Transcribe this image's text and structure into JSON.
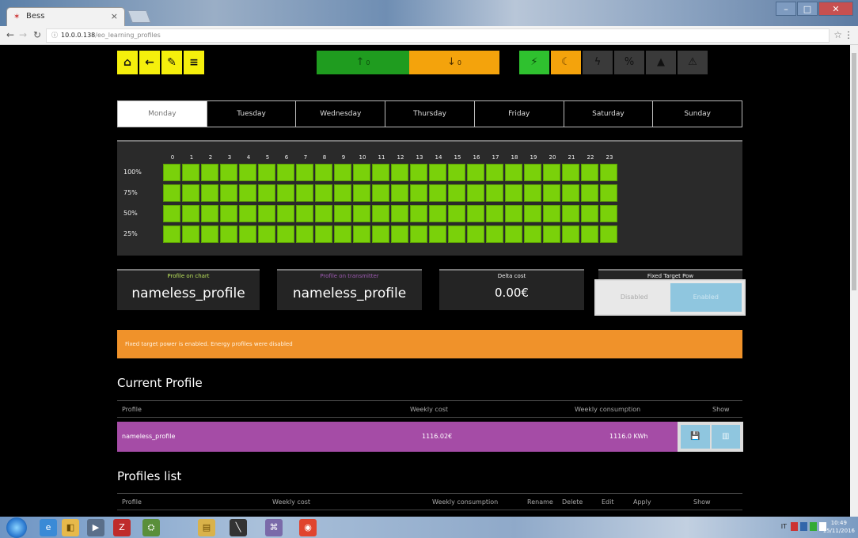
{
  "browser": {
    "tab_title": "Bess",
    "tab_favicon": "✶",
    "tab_close": "×",
    "url_host": "10.0.0.138",
    "url_path": "/eo_learning_profiles",
    "win_min": "–",
    "win_max": "□",
    "win_close": "✕"
  },
  "toolbar": {
    "nav_buttons": [
      {
        "name": "home-icon",
        "glyph": "⌂"
      },
      {
        "name": "back-arrow-icon",
        "glyph": "←"
      },
      {
        "name": "wrench-icon",
        "glyph": "✎"
      },
      {
        "name": "menu-icon",
        "glyph": "≡"
      }
    ],
    "power_in_glyph": "↑",
    "power_in_value": "0",
    "power_out_glyph": "↓",
    "power_out_value": "0",
    "status_icons": [
      {
        "name": "plug-icon",
        "glyph": "⚡",
        "state": "green"
      },
      {
        "name": "moon-icon",
        "glyph": "☾",
        "state": "orange"
      },
      {
        "name": "bolt-icon",
        "glyph": "ϟ",
        "state": "grey"
      },
      {
        "name": "percent-icon",
        "glyph": "%",
        "state": "grey"
      },
      {
        "name": "lock-icon",
        "glyph": "▲",
        "state": "grey"
      },
      {
        "name": "warning-icon",
        "glyph": "⚠",
        "state": "grey"
      }
    ],
    "colors": {
      "nav": "#f5ef0c",
      "power_in": "#1f9c1f",
      "power_out": "#f4a30c"
    }
  },
  "days": [
    "Monday",
    "Tuesday",
    "Wednesday",
    "Thursday",
    "Friday",
    "Saturday",
    "Sunday"
  ],
  "active_day": "Monday",
  "power_grid": {
    "hours": [
      "0",
      "1",
      "2",
      "3",
      "4",
      "5",
      "6",
      "7",
      "8",
      "9",
      "10",
      "11",
      "12",
      "13",
      "14",
      "15",
      "16",
      "17",
      "18",
      "19",
      "20",
      "21",
      "22",
      "23"
    ],
    "levels": [
      "100%",
      "75%",
      "50%",
      "25%"
    ],
    "selected_level_per_hour": [
      "100%",
      "100%",
      "100%",
      "100%",
      "100%",
      "100%",
      "100%",
      "100%",
      "100%",
      "100%",
      "100%",
      "100%",
      "100%",
      "100%",
      "100%",
      "100%",
      "100%",
      "100%",
      "100%",
      "100%",
      "100%",
      "100%",
      "100%",
      "100%"
    ],
    "cell_color": "#7ad10a"
  },
  "cards": {
    "profile_on_chart": {
      "caption": "Profile on chart",
      "value": "nameless_profile"
    },
    "profile_on_transmitter": {
      "caption": "Profile on transmitter",
      "value": "nameless_profile"
    },
    "delta_cost": {
      "caption": "Delta cost",
      "value": "0.00€"
    },
    "fixed_target": {
      "caption": "Fixed Target Pow",
      "off_label": "Disabled",
      "on_label": "Enabled"
    }
  },
  "warning_text": "Fixed target power is enabled. Energy profiles were disabled",
  "current_profile": {
    "title": "Current Profile",
    "headers": {
      "profile": "Profile",
      "weekly_cost": "Weekly cost",
      "weekly_consumption": "Weekly consumption",
      "show": "Show"
    },
    "row": {
      "profile": "nameless_profile",
      "weekly_cost": "1116.02€",
      "weekly_consumption": "1116.0 KWh"
    },
    "save_glyph": "💾",
    "chart_glyph": "▥",
    "row_color": "#a54ca6"
  },
  "profiles_list": {
    "title": "Profiles list",
    "headers": {
      "profile": "Profile",
      "weekly_cost": "Weekly cost",
      "weekly_consumption": "Weekly consumption",
      "rename": "Rename",
      "delete": "Delete",
      "edit": "Edit",
      "apply": "Apply",
      "show": "Show"
    }
  },
  "taskbar": {
    "start_glyph": "",
    "ie": "e",
    "explorer": "◧",
    "media": "▶",
    "filezilla": "Z",
    "network": "⛭",
    "files": "▤",
    "usb": "╲",
    "app": "⌘",
    "chrome": "◉",
    "lang": "IT",
    "clock_time": "10:49",
    "clock_date": "15/11/2016"
  }
}
